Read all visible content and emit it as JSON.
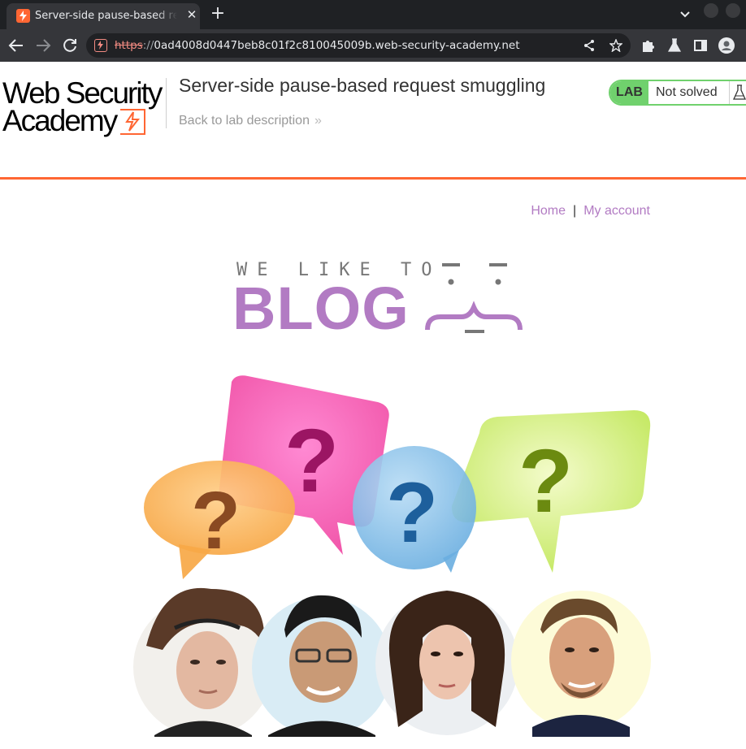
{
  "browser": {
    "tab_title": "Server-side pause-based request smuggling",
    "tab_close_icon": "close-icon",
    "new_tab_icon": "plus-icon",
    "url_scheme": "https",
    "url_separator": "://",
    "url_host": "0ad4008d0447beb8c01f2c810045009b.web-security-academy.net",
    "accent_color": "#ff6633"
  },
  "lab_header": {
    "logo_line1": "Web Security",
    "logo_line2": "Academy",
    "title": "Server-side pause-based request smuggling",
    "back_link": "Back to lab description",
    "back_chevron": "»",
    "status_badge": "LAB",
    "status_text": "Not solved",
    "status_color": "#70d16d"
  },
  "nav": {
    "home": "Home",
    "separator": "|",
    "my_account": "My account",
    "link_color": "#b27bc3"
  },
  "banner": {
    "tagline": "WE LIKE TO",
    "word": "BLOG"
  }
}
